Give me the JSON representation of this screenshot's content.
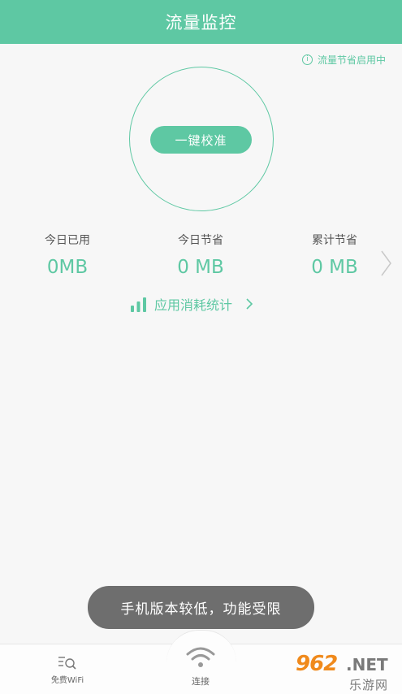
{
  "header": {
    "title": "流量监控"
  },
  "saver_status": {
    "icon": "info-icon",
    "text": "流量节省启用中"
  },
  "calibrate": {
    "label": "一键校准"
  },
  "stats": [
    {
      "label": "今日已用",
      "value": "0MB"
    },
    {
      "label": "今日节省",
      "value": "0 MB"
    },
    {
      "label": "累计节省",
      "value": "0 MB"
    }
  ],
  "app_usage": {
    "label": "应用消耗统计",
    "icon": "signal-bars-icon"
  },
  "toast": {
    "message": "手机版本较低，功能受限"
  },
  "tabbar": {
    "tabs": [
      {
        "label": "免费WiFi",
        "icon": "wifi-search-icon"
      },
      {
        "label": "连接",
        "icon": "wifi-icon"
      }
    ]
  },
  "watermark": {
    "number": "962",
    "domain": ".NET",
    "sub": "乐游网"
  },
  "colors": {
    "accent": "#5ec8a3",
    "toast_bg": "#6e6e6e",
    "background": "#f7f7f7"
  }
}
